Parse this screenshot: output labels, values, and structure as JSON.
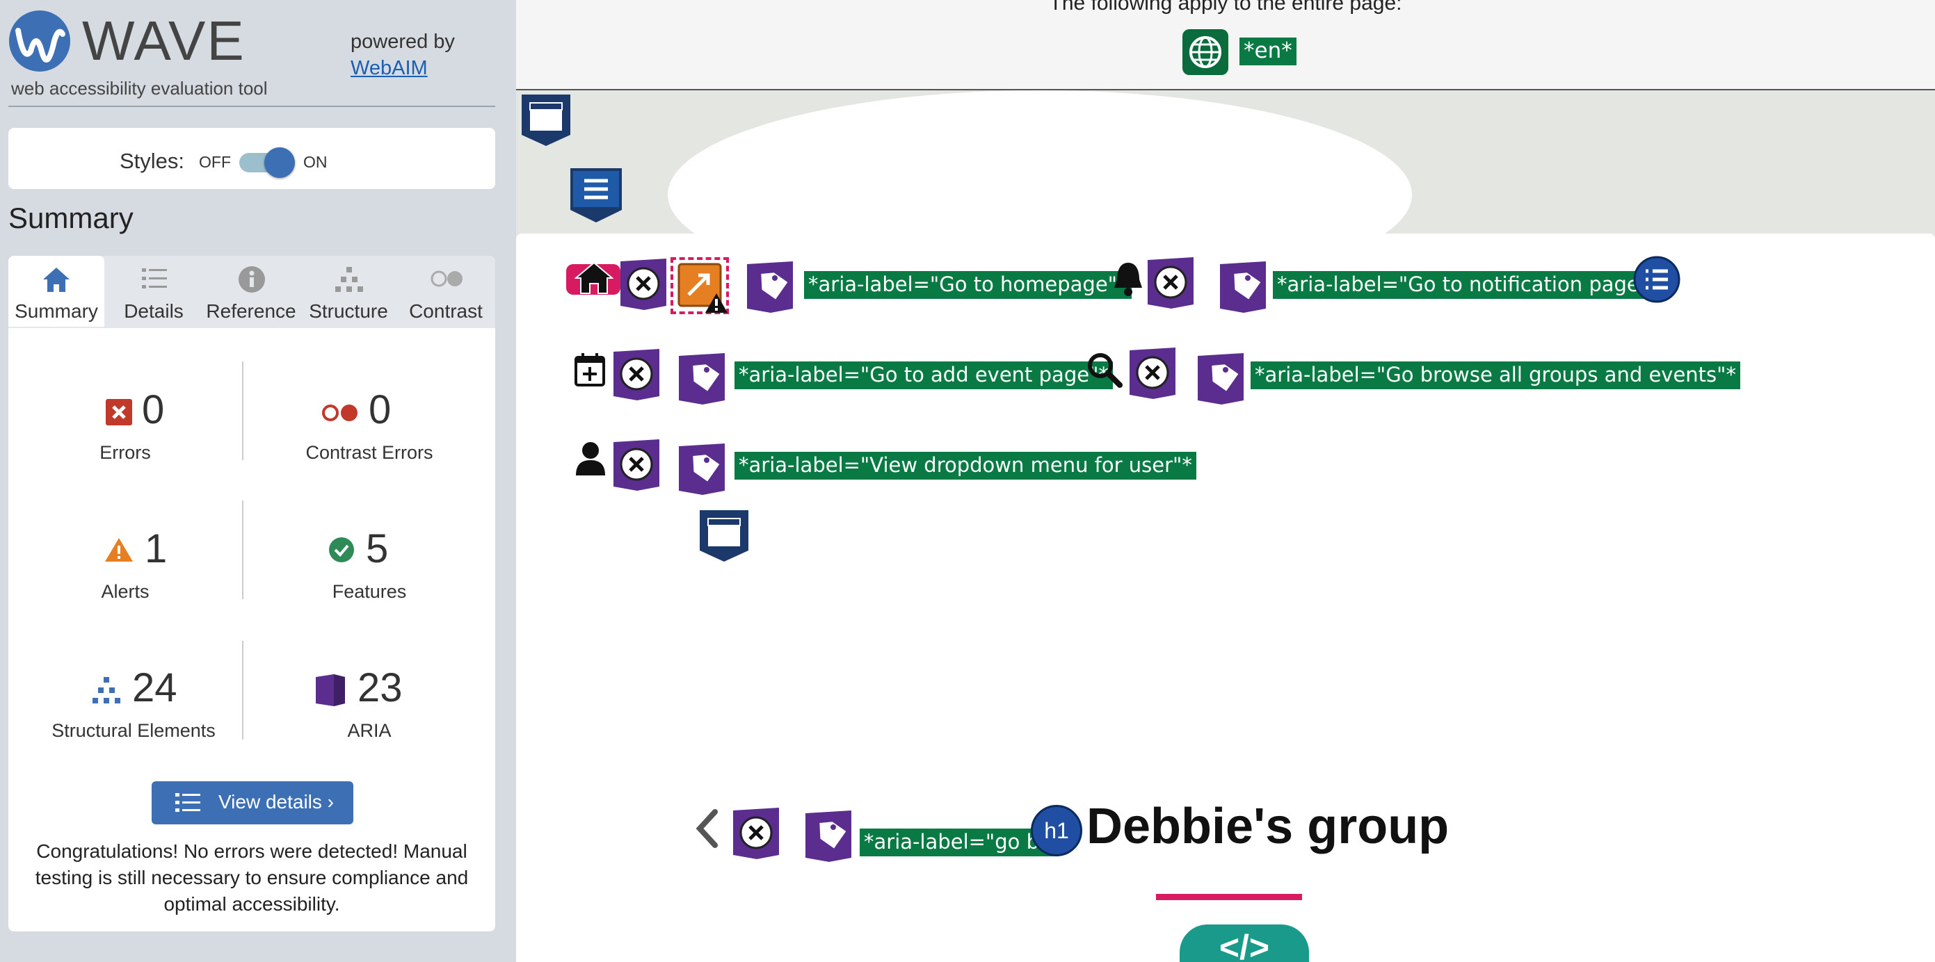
{
  "brand": {
    "logo_text": "WAVE",
    "tagline": "web accessibility evaluation tool",
    "powered_by": "powered by",
    "webaim_link": "WebAIM"
  },
  "styles_toggle": {
    "label": "Styles:",
    "off": "OFF",
    "on": "ON",
    "state": "on"
  },
  "summary_heading": "Summary",
  "tabs": [
    {
      "label": "Summary",
      "icon": "home-icon",
      "active": true
    },
    {
      "label": "Details",
      "icon": "list-icon",
      "active": false
    },
    {
      "label": "Reference",
      "icon": "info-icon",
      "active": false
    },
    {
      "label": "Structure",
      "icon": "hierarchy-icon",
      "active": false
    },
    {
      "label": "Contrast",
      "icon": "contrast-icon",
      "active": false
    }
  ],
  "stats": {
    "errors": {
      "count": "0",
      "label": "Errors"
    },
    "contrast_errors": {
      "count": "0",
      "label": "Contrast Errors"
    },
    "alerts": {
      "count": "1",
      "label": "Alerts"
    },
    "features": {
      "count": "5",
      "label": "Features"
    },
    "structural": {
      "count": "24",
      "label": "Structural Elements"
    },
    "aria": {
      "count": "23",
      "label": "ARIA"
    }
  },
  "view_details_button": "View details ›",
  "congrats_message": "Congratulations! No errors were detected! Manual testing is still necessary to ensure compliance and optimal accessibility.",
  "page_notice": "The following apply to the entire page:",
  "lang_label": "*en*",
  "aria_labels": {
    "home": "*aria-label=\"Go to homepage\"*",
    "notification": "*aria-label=\"Go to notification page\"*",
    "add_event": "*aria-label=\"Go to add event page\"*",
    "browse": "*aria-label=\"Go browse all groups and events\"*",
    "user_menu": "*aria-label=\"View dropdown menu for user\"*",
    "go_back": "*aria-label=\"go back\"*"
  },
  "heading_badge": "h1",
  "page_heading": "Debbie's group",
  "code_badge": "</>",
  "colors": {
    "aria_label_bg": "#0a7a45",
    "aria_purple": "#5b2d8e",
    "wave_blue": "#3d6fb4",
    "error_red": "#c0392b",
    "alert_orange": "#e67e22",
    "feature_green": "#2e8b57",
    "accent_pink": "#d81b60"
  }
}
